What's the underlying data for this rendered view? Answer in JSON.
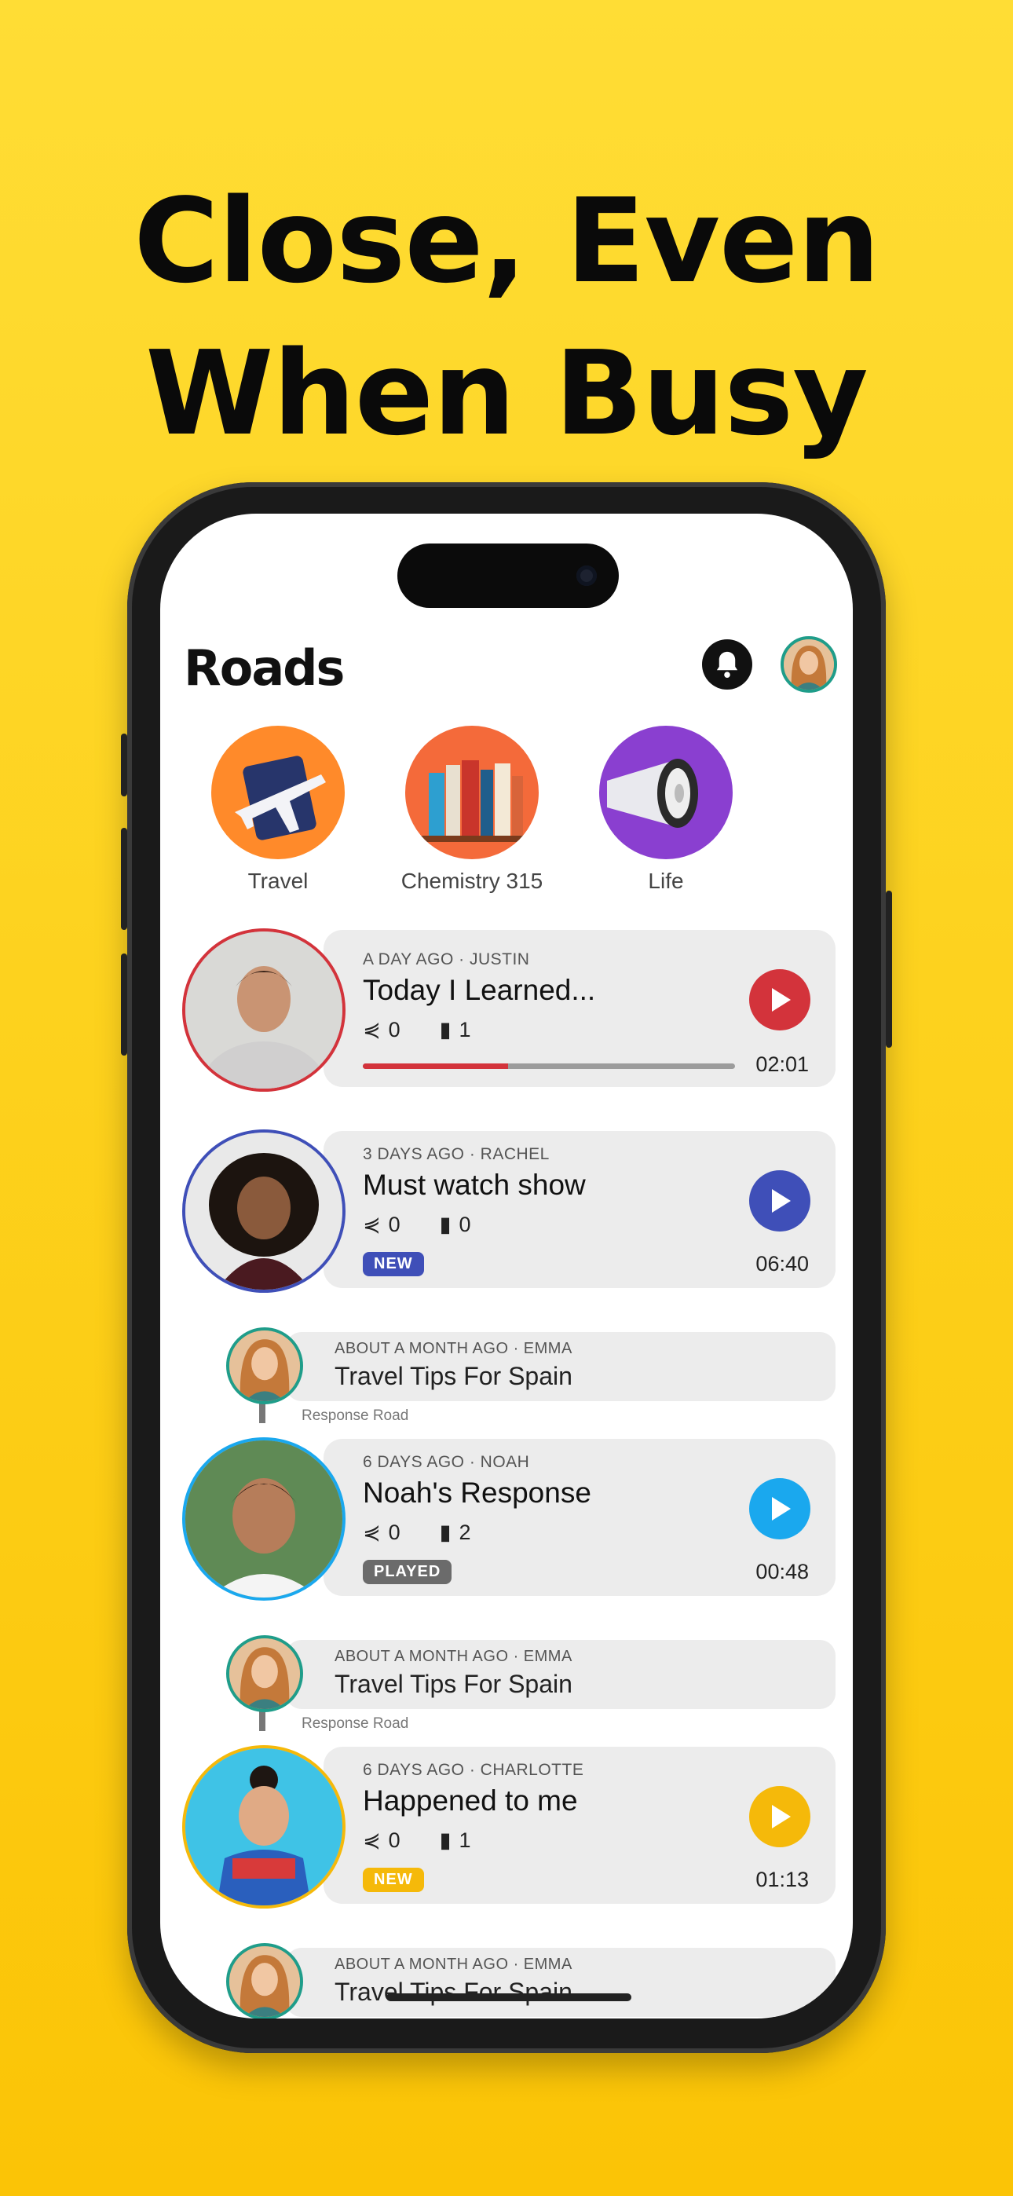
{
  "headline": {
    "line1": "Close, Even",
    "line2": "When Busy"
  },
  "app": {
    "logo": "Roads",
    "header_icons": [
      "bell-icon",
      "profile-avatar"
    ]
  },
  "categories": [
    {
      "label": "Travel",
      "icon": "airplane-passport-icon",
      "color": "#FF8A2A"
    },
    {
      "label": "Chemistry 315",
      "icon": "books-icon",
      "color": "#F46A3A"
    },
    {
      "label": "Life",
      "icon": "megaphone-icon",
      "color": "#8A3FD0"
    }
  ],
  "posts": [
    {
      "meta": "A DAY AGO · JUSTIN",
      "title": "Today I Learned...",
      "shares": "0",
      "listens": "1",
      "duration": "02:01",
      "progress": 0.39,
      "accent": "#D3333B"
    },
    {
      "meta": "3 DAYS AGO · RACHEL",
      "title": "Must watch show",
      "shares": "0",
      "listens": "0",
      "duration": "06:40",
      "badge": "NEW",
      "accent": "#3F4FB8"
    },
    {
      "meta": "6 DAYS AGO · NOAH",
      "title": "Noah's Response",
      "shares": "0",
      "listens": "2",
      "duration": "00:48",
      "badge": "PLAYED",
      "accent": "#1AA8EE",
      "badge_color": "#6b6b6b",
      "parent": {
        "meta": "ABOUT A MONTH AGO · EMMA",
        "title": "Travel Tips For Spain",
        "link_label": "Response Road"
      }
    },
    {
      "meta": "6 DAYS AGO · CHARLOTTE",
      "title": "Happened to me",
      "shares": "0",
      "listens": "1",
      "duration": "01:13",
      "badge": "NEW",
      "accent": "#F5B90A",
      "parent": {
        "meta": "ABOUT A MONTH AGO · EMMA",
        "title": "Travel Tips For Spain",
        "link_label": "Response Road"
      }
    }
  ],
  "trailing_parent": {
    "meta": "ABOUT A MONTH AGO · EMMA",
    "title": "Travel Tips For Spain"
  }
}
